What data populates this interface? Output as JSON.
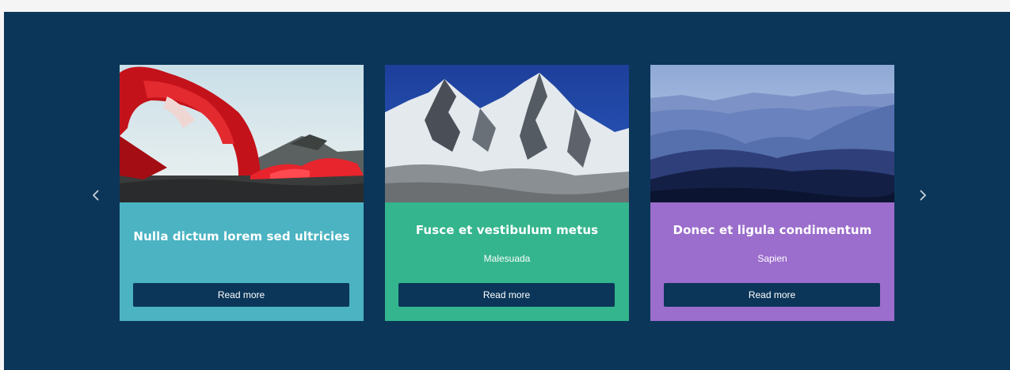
{
  "carousel": {
    "prev_icon": "chevron-left-icon",
    "next_icon": "chevron-right-icon",
    "colors": {
      "background": "#0b3659",
      "button": "#0b3659"
    },
    "cards": [
      {
        "title": "Nulla dictum lorem sed ultricies",
        "subtitle": "",
        "button_label": "Read more",
        "color": "#4bb3c2"
      },
      {
        "title": "Fusce et vestibulum metus",
        "subtitle": "Malesuada",
        "button_label": "Read more",
        "color": "#34b58d"
      },
      {
        "title": "Donec et ligula condimentum",
        "subtitle": "Sapien",
        "button_label": "Read more",
        "color": "#9b6dcc"
      }
    ]
  }
}
